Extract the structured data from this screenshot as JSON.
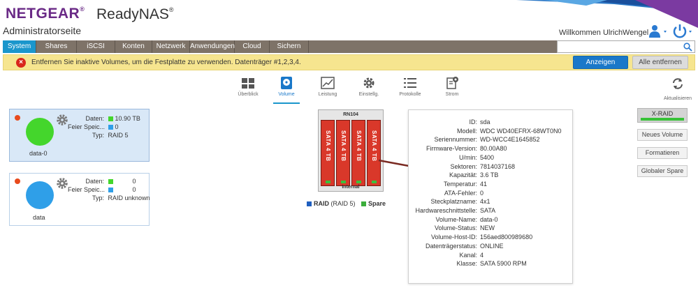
{
  "header": {
    "brand": "NETGEAR",
    "brand_reg": "®",
    "product": "ReadyNAS",
    "product_reg": "®",
    "subtitle": "Administratorseite",
    "welcome": "Willkommen UlrichWengel"
  },
  "nav": {
    "tabs": [
      "System",
      "Shares",
      "iSCSI",
      "Konten",
      "Netzwerk",
      "Anwendungen",
      "Cloud",
      "Sichern"
    ],
    "active": "System",
    "search_placeholder": ""
  },
  "alert": {
    "text": "Entfernen Sie inaktive Volumes, um die Festplatte zu verwenden. Datenträger #1,2,3,4.",
    "show_button": "Anzeigen",
    "remove_all_button": "Alle entfernen"
  },
  "subtabs": {
    "overview": "Überblick",
    "volume": "Volume",
    "performance": "Leistung",
    "settings": "Einstellg.",
    "logs": "Protokolle",
    "power": "Strom",
    "refresh": "Aktualisieren"
  },
  "volumes": [
    {
      "name": "data-0",
      "color": "#44d62c",
      "data_label": "Daten:",
      "data_value": "10.90 TB",
      "free_label": "Feier Speic...",
      "free_value": "0",
      "type_label": "Typ:",
      "type_value": "RAID 5"
    },
    {
      "name": "data",
      "color": "#2f9fe8",
      "data_label": "Daten:",
      "data_value": "0",
      "free_label": "Feier Speic...",
      "free_value": "0",
      "type_label": "Typ:",
      "type_value": "RAID unknown"
    }
  ],
  "device": {
    "model": "RN104",
    "bay_label": "SATA 4 TB",
    "internal_label": "Internal"
  },
  "legend": {
    "raid_label": "RAID",
    "raid_detail": "(RAID 5)",
    "spare_label": "Spare"
  },
  "disk_details": [
    {
      "k": "ID:",
      "v": "sda"
    },
    {
      "k": "Modell:",
      "v": "WDC WD40EFRX-68WT0N0"
    },
    {
      "k": "Seriennummer:",
      "v": "WD-WCC4E1645852"
    },
    {
      "k": "Firmware-Version:",
      "v": "80.00A80"
    },
    {
      "k": "U/min:",
      "v": "5400"
    },
    {
      "k": "Sektoren:",
      "v": "7814037168"
    },
    {
      "k": "Kapazität:",
      "v": "3.6 TB"
    },
    {
      "k": "Temperatur:",
      "v": "41"
    },
    {
      "k": "ATA-Fehler:",
      "v": "0"
    },
    {
      "k": "Steckplatzname:",
      "v": "4x1"
    },
    {
      "k": "Hardwareschnittstelle:",
      "v": "SATA"
    },
    {
      "k": "Volume-Name:",
      "v": "data-0"
    },
    {
      "k": "Volume-Status:",
      "v": "NEW"
    },
    {
      "k": "Volume-Host-ID:",
      "v": "156aed800989680"
    },
    {
      "k": "Datenträgerstatus:",
      "v": "ONLINE"
    },
    {
      "k": "Kanal:",
      "v": "4"
    },
    {
      "k": "Klasse:",
      "v": "SATA 5900 RPM"
    }
  ],
  "right_panel": {
    "xraid": "X-RAID",
    "new_volume": "Neues Volume",
    "format": "Formatieren",
    "global_spare": "Globaler Spare"
  },
  "colors": {
    "nav_bg": "#7e7368",
    "nav_active": "#1a96cc",
    "alert_bg": "#f6e58f",
    "primary": "#1a78c9",
    "brand": "#6a2a86",
    "raid": "#1f5fbf",
    "spare": "#3cae3c",
    "status_error": "#e84a1c"
  }
}
